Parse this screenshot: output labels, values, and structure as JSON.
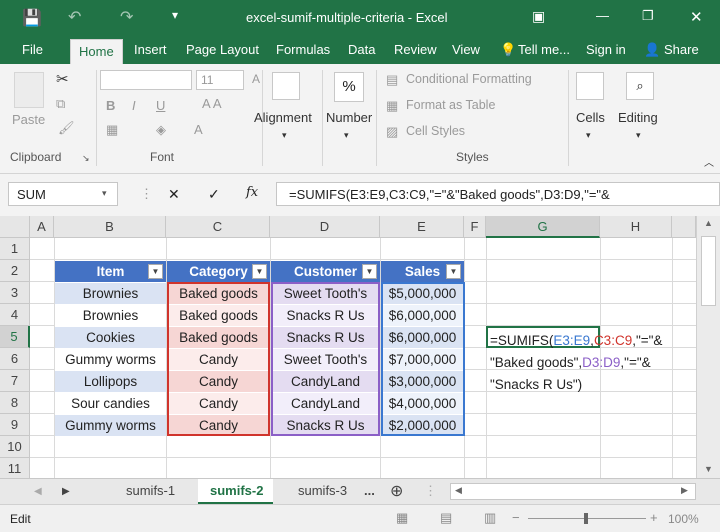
{
  "titlebar": {
    "title": "excel-sumif-multiple-criteria - Excel",
    "save_icon": "save-icon",
    "undo_icon": "undo-icon",
    "redo_icon": "redo-icon",
    "minimize": "—",
    "restore": "❐",
    "close": "✕"
  },
  "tabs": [
    "File",
    "Home",
    "Insert",
    "Page Layout",
    "Formulas",
    "Data",
    "Review",
    "View"
  ],
  "tell_me": "Tell me...",
  "sign_in": "Sign in",
  "share": "Share",
  "ribbon": {
    "paste": "Paste",
    "clipboard": "Clipboard",
    "font_name": "",
    "font_size": "11",
    "bold": "B",
    "italic": "I",
    "underline": "U",
    "font_group": "Font",
    "alignment": "Alignment",
    "number": "Number",
    "percent": "%",
    "conditional_formatting": "Conditional Formatting",
    "format_as_table": "Format as Table",
    "cell_styles": "Cell Styles",
    "styles_group": "Styles",
    "cells": "Cells",
    "editing": "Editing"
  },
  "formula_bar": {
    "name_box": "SUM",
    "cancel": "✕",
    "enter": "✓",
    "fx": "fx",
    "formula": "=SUMIFS(E3:E9,C3:C9,\"=\"&\"Baked goods\",D3:D9,\"=\"&"
  },
  "columns": [
    "A",
    "B",
    "C",
    "D",
    "E",
    "F",
    "G",
    "H"
  ],
  "rows": [
    "1",
    "2",
    "3",
    "4",
    "5",
    "6",
    "7",
    "8",
    "9",
    "10",
    "11"
  ],
  "table": {
    "headers": [
      "Item",
      "Category",
      "Customer",
      "Sales"
    ],
    "rows": [
      [
        "Brownies",
        "Baked goods",
        "Sweet Tooth's",
        "$5,000,000"
      ],
      [
        "Brownies",
        "Baked goods",
        "Snacks R Us",
        "$6,000,000"
      ],
      [
        "Cookies",
        "Baked goods",
        "Snacks R Us",
        "$6,000,000"
      ],
      [
        "Gummy worms",
        "Candy",
        "Sweet Tooth's",
        "$7,000,000"
      ],
      [
        "Lollipops",
        "Candy",
        "CandyLand",
        "$3,000,000"
      ],
      [
        "Sour candies",
        "Candy",
        "CandyLand",
        "$4,000,000"
      ],
      [
        "Gummy worms",
        "Candy",
        "Snacks R Us",
        "$2,000,000"
      ]
    ]
  },
  "edit_cell": {
    "line1_a": "=SUMIFS(",
    "line1_b": "E3:E9",
    "line1_c": ",",
    "line1_d": "C3:C9",
    "line1_e": ",\"=\"&",
    "line2_a": "\"Baked goods\",",
    "line2_b": "D3:D9",
    "line2_c": ",\"=\"&",
    "line3": "\"Snacks R Us\")"
  },
  "sheets": [
    "sumifs-1",
    "sumifs-2",
    "sumifs-3"
  ],
  "sheets_more": "...",
  "add_sheet": "⊕",
  "status": {
    "mode": "Edit",
    "zoom": "100%",
    "minus": "−",
    "plus": "+"
  },
  "colors": {
    "excel_green": "#217346",
    "header_blue": "#4472c4",
    "range_blue": "#3a78d0",
    "range_red": "#d0342c",
    "range_purple": "#8b5fc7"
  }
}
